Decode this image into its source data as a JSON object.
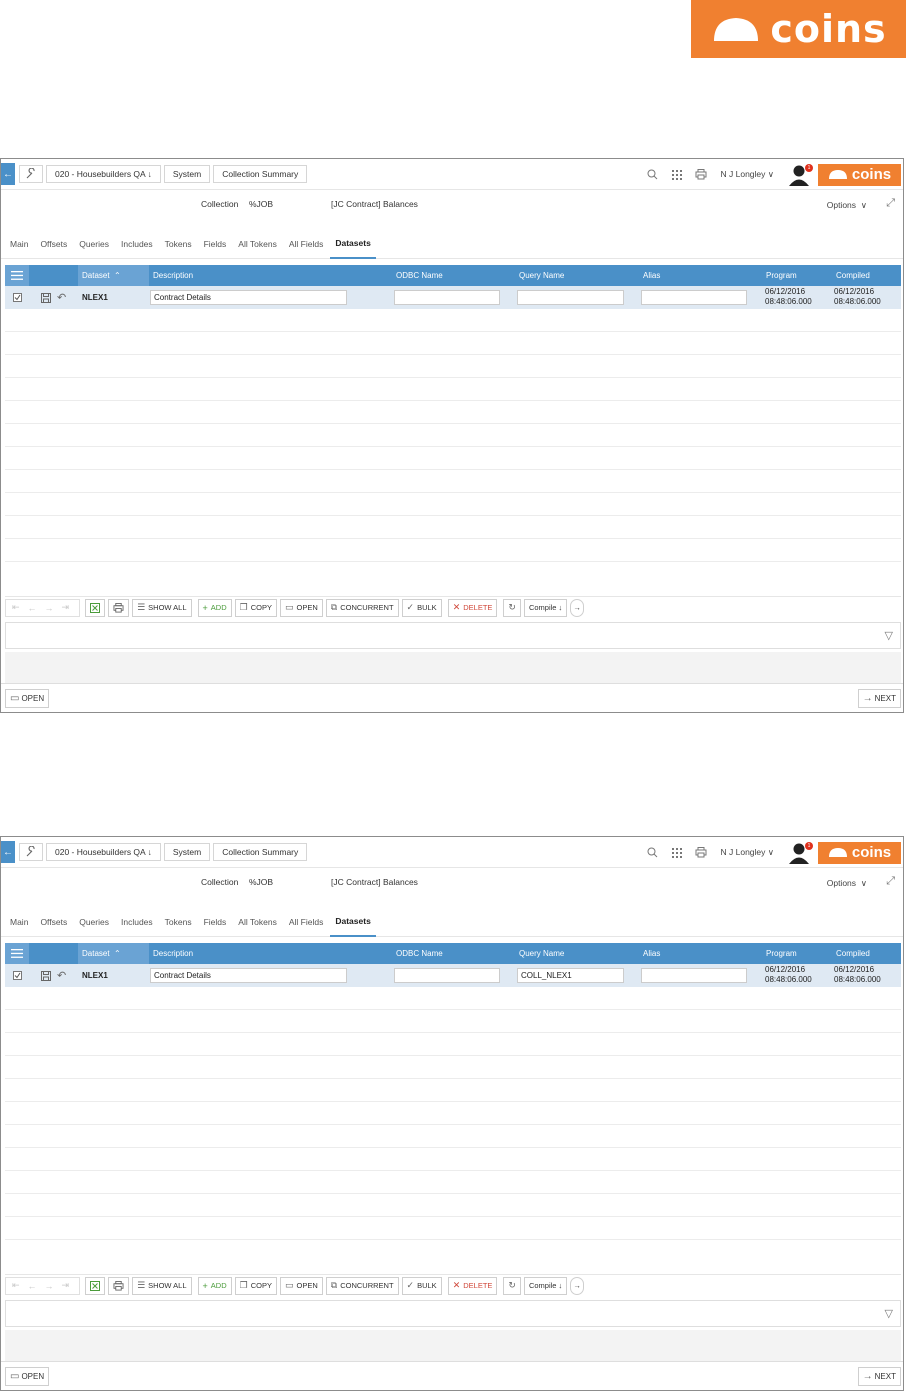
{
  "logo": {
    "word": "coins"
  },
  "screens": [
    {
      "topbar": {
        "back_icon": "arrow-left-icon",
        "crumbs": [
          "020 - Housebuilders QA ↓",
          "System",
          "Collection Summary"
        ],
        "user": "N J Longley",
        "badge": "1",
        "brand": "coins"
      },
      "collection": {
        "label": "Collection",
        "value": "%JOB",
        "title": "[JC Contract] Balances"
      },
      "options": "Options",
      "tabs": [
        "Main",
        "Offsets",
        "Queries",
        "Includes",
        "Tokens",
        "Fields",
        "All Tokens",
        "All Fields",
        "Datasets"
      ],
      "active_tab": "Datasets",
      "grid": {
        "columns": [
          "Dataset",
          "Description",
          "ODBC Name",
          "Query Name",
          "Alias",
          "Program",
          "Compiled"
        ],
        "row": {
          "dataset": "NLEX1",
          "description": "Contract Details",
          "odbc_name": "",
          "query_name": "",
          "alias": "",
          "program_date": "06/12/2016",
          "program_time": "08:48:06.000",
          "compiled_date": "06/12/2016",
          "compiled_time": "08:48:06.000"
        }
      },
      "toolbar": {
        "show_all": "SHOW ALL",
        "add": "ADD",
        "copy": "COPY",
        "open": "OPEN",
        "concurrent": "CONCURRENT",
        "bulk": "BULK",
        "delete": "DELETE",
        "compile": "Compile ↓"
      },
      "bottom": {
        "open": "OPEN",
        "next": "NEXT"
      }
    },
    {
      "topbar": {
        "back_icon": "arrow-left-icon",
        "crumbs": [
          "020 - Housebuilders QA ↓",
          "System",
          "Collection Summary"
        ],
        "user": "N J Longley",
        "badge": "1",
        "brand": "coins"
      },
      "collection": {
        "label": "Collection",
        "value": "%JOB",
        "title": "[JC Contract] Balances"
      },
      "options": "Options",
      "tabs": [
        "Main",
        "Offsets",
        "Queries",
        "Includes",
        "Tokens",
        "Fields",
        "All Tokens",
        "All Fields",
        "Datasets"
      ],
      "active_tab": "Datasets",
      "grid": {
        "columns": [
          "Dataset",
          "Description",
          "ODBC Name",
          "Query Name",
          "Alias",
          "Program",
          "Compiled"
        ],
        "row": {
          "dataset": "NLEX1",
          "description": "Contract Details",
          "odbc_name": "",
          "query_name": "COLL_NLEX1",
          "alias": "",
          "program_date": "06/12/2016",
          "program_time": "08:48:06.000",
          "compiled_date": "06/12/2016",
          "compiled_time": "08:48:06.000"
        }
      },
      "toolbar": {
        "show_all": "SHOW ALL",
        "add": "ADD",
        "copy": "COPY",
        "open": "OPEN",
        "concurrent": "CONCURRENT",
        "bulk": "BULK",
        "delete": "DELETE",
        "compile": "Compile ↓"
      },
      "bottom": {
        "open": "OPEN",
        "next": "NEXT"
      }
    }
  ]
}
